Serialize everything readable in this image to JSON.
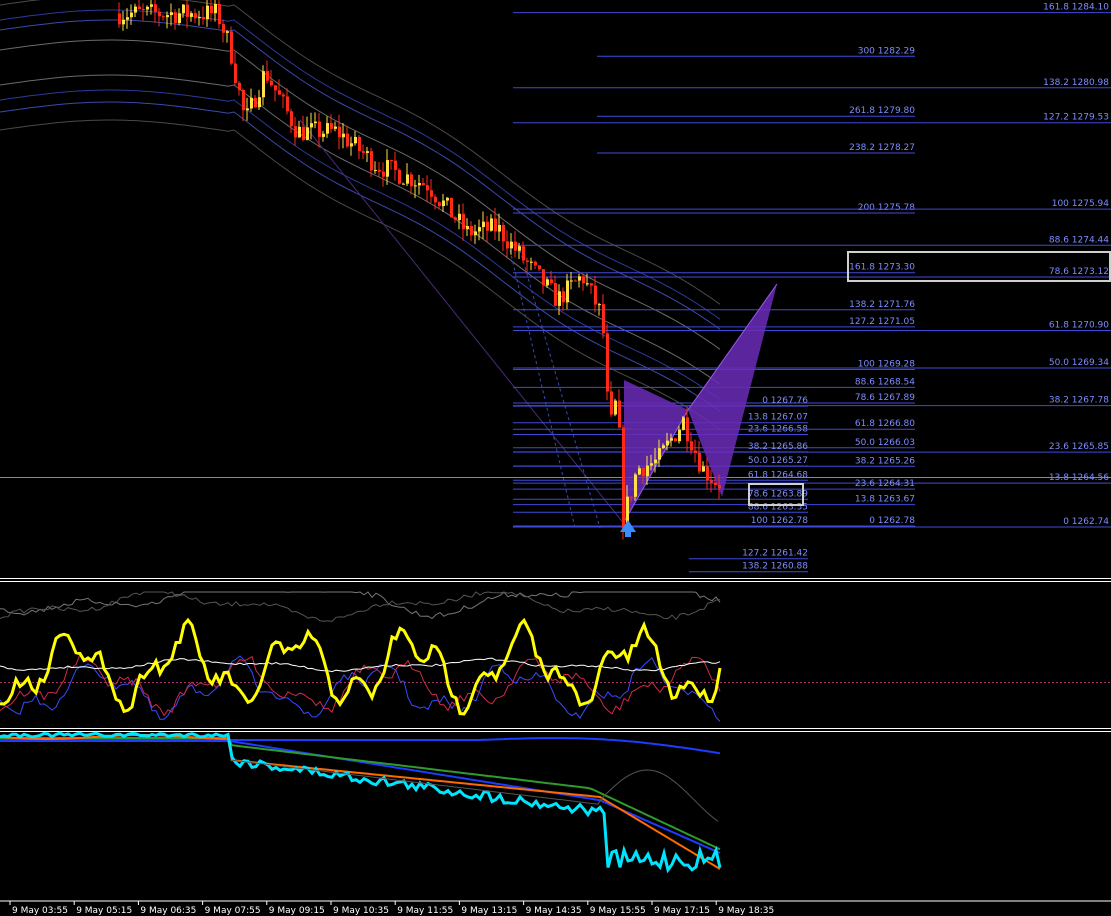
{
  "chart_data": {
    "type": "candlestick",
    "instrument_price_range": [
      1260.88,
      1284.1
    ],
    "time_labels": [
      "9 May 03:55",
      "9 May 05:15",
      "9 May 06:35",
      "9 May 07:55",
      "9 May 09:15",
      "9 May 10:35",
      "9 May 11:55",
      "9 May 13:15",
      "9 May 14:35",
      "9 May 15:55",
      "9 May 17:15",
      "9 May 18:35"
    ],
    "fib_levels": [
      {
        "label": "161.8 1284.10",
        "group": "right"
      },
      {
        "label": "300 1282.29",
        "group": "mid"
      },
      {
        "label": "138.2 1280.98",
        "group": "right"
      },
      {
        "label": "261.8 1279.80",
        "group": "mid"
      },
      {
        "label": "127.2 1279.53",
        "group": "right"
      },
      {
        "label": "238.2 1278.27",
        "group": "mid"
      },
      {
        "label": "200 1275.78",
        "group": "mid"
      },
      {
        "label": "100 1275.94",
        "group": "right"
      },
      {
        "label": "88.6 1274.44",
        "group": "right"
      },
      {
        "label": "161.8 1273.30",
        "group": "mid"
      },
      {
        "label": "78.6 1273.12",
        "group": "right"
      },
      {
        "label": "138.2 1271.76",
        "group": "mid"
      },
      {
        "label": "127.2 1271.05",
        "group": "mid"
      },
      {
        "label": "61.8 1270.90",
        "group": "right"
      },
      {
        "label": "100 1269.28",
        "group": "mid"
      },
      {
        "label": "50.0 1269.34",
        "group": "right"
      },
      {
        "label": "88.6 1268.54",
        "group": "mid"
      },
      {
        "label": "78.6 1267.89",
        "group": "mid"
      },
      {
        "label": "0 1267.76",
        "group": "left"
      },
      {
        "label": "38.2 1267.78",
        "group": "right"
      },
      {
        "label": "13.8 1267.07",
        "group": "left"
      },
      {
        "label": "23.6 1266.58",
        "group": "left"
      },
      {
        "label": "61.8 1266.80",
        "group": "mid"
      },
      {
        "label": "50.0 1266.03",
        "group": "mid"
      },
      {
        "label": "38.2 1265.86",
        "group": "left"
      },
      {
        "label": "23.6 1265.85",
        "group": "right"
      },
      {
        "label": "50.0 1265.27",
        "group": "left"
      },
      {
        "label": "38.2 1265.26",
        "group": "mid"
      },
      {
        "label": "61.8 1264.68",
        "group": "left"
      },
      {
        "label": "13.8 1264.56",
        "group": "right"
      },
      {
        "label": "23.6 1264.31",
        "group": "mid"
      },
      {
        "label": "78.6 1263.89",
        "group": "left"
      },
      {
        "label": "13.8 1263.67",
        "group": "mid"
      },
      {
        "label": "88.6 1263.35",
        "group": "left"
      },
      {
        "label": "100 1262.78",
        "group": "left"
      },
      {
        "label": "0 1262.78",
        "group": "mid"
      },
      {
        "label": "0 1262.74",
        "group": "right"
      },
      {
        "label": "127.2 1261.42",
        "group": "left"
      },
      {
        "label": "138.2 1260.88",
        "group": "left"
      }
    ]
  },
  "colors": {
    "background": "#000000",
    "fib_line": "#3f4ad8",
    "fib_text": "#7d8cff",
    "candle_up": "#ffe14a",
    "candle_down": "#ff2a1a",
    "pattern_fill": "#6a2bb8",
    "oscillator_main": "#ffff00",
    "oscillator_signal": "#00e5ff",
    "ma_slow": "#1d3cff",
    "ma_mid": "#2f9b2f",
    "ma_fast": "#ff6a00",
    "highlight_box": "#cfcfcf"
  }
}
